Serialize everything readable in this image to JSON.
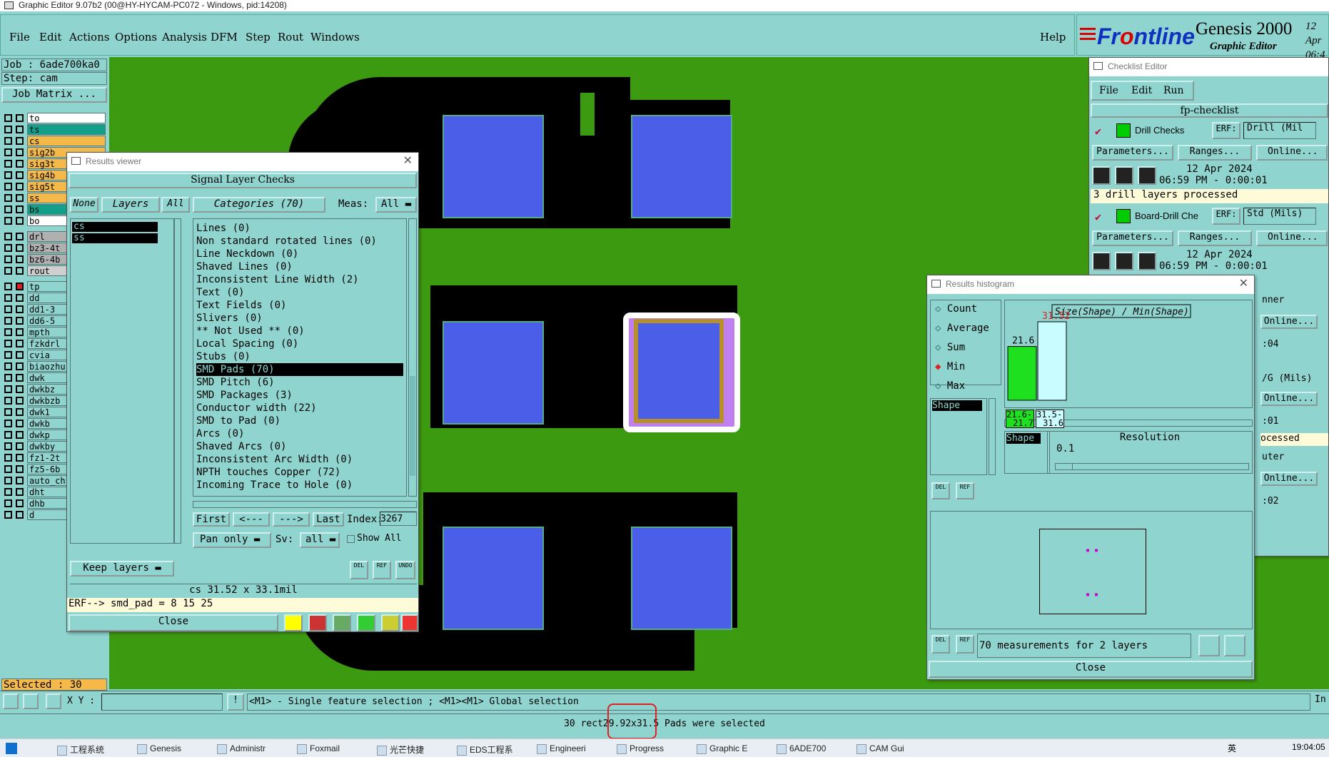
{
  "window_title": "Graphic Editor 9.07b2 (00@HY-HYCAM-PC072 - Windows, pid:14208)",
  "menu": [
    "File",
    "Edit",
    "Actions",
    "Options",
    "Analysis",
    "DFM",
    "Step",
    "Rout",
    "Windows"
  ],
  "help": "Help",
  "logo": {
    "brand_a": "Fr",
    "brand_b": "ntline",
    "product": "Genesis 2000",
    "sub": "Graphic Editor",
    "date_line": "12 Apr",
    "time_line": "06:4"
  },
  "left": {
    "job": "Job : 6ade700ka0",
    "step": "Step: cam",
    "job_matrix": "Job Matrix ...",
    "layers_top": [
      {
        "name": "to",
        "color": "#ffffff"
      },
      {
        "name": "ts",
        "color": "#12a08a"
      },
      {
        "name": "cs",
        "color": "#f5b94a"
      },
      {
        "name": "sig2b",
        "color": "#f5b94a"
      },
      {
        "name": "sig3t",
        "color": "#f5b94a"
      },
      {
        "name": "sig4b",
        "color": "#f5b94a"
      },
      {
        "name": "sig5t",
        "color": "#f5b94a"
      },
      {
        "name": "ss",
        "color": "#f5b94a"
      },
      {
        "name": "bs",
        "color": "#12a08a"
      },
      {
        "name": "bo",
        "color": "#ffffff"
      }
    ],
    "layers_drill": [
      {
        "name": "drl",
        "color": "#b0b0b0"
      },
      {
        "name": "bz3-4t",
        "color": "#b0b0b0"
      },
      {
        "name": "bz6-4b",
        "color": "#b0b0b0"
      },
      {
        "name": "rout",
        "color": "#cfcfcf"
      }
    ],
    "layers_misc": [
      "tp",
      "dd",
      "dd1-3",
      "dd6-5",
      "mpth",
      "fzkdrl",
      "cvia",
      "biaozhu",
      "dwk",
      "dwkbz",
      "dwkbzb",
      "dwk1",
      "dwkb",
      "dwkp",
      "dwkby",
      "fz1-2t",
      "fz5-6b",
      "auto_chk",
      "dht",
      "dhb",
      "d"
    ],
    "selected": "Selected : 30"
  },
  "results_viewer": {
    "title": "Results viewer",
    "header": "Signal Layer Checks",
    "none": "None",
    "layers": "Layers",
    "all": "All",
    "categories_btn": "Categories (70)",
    "meas_label": "Meas:",
    "meas_value": "All",
    "layer_list": [
      "cs",
      "ss"
    ],
    "categories": [
      "Lines (0)",
      "Non standard rotated lines (0)",
      "Line Neckdown (0)",
      "Shaved Lines (0)",
      "Inconsistent Line Width (2)",
      "Text (0)",
      "Text Fields (0)",
      "Slivers (0)",
      "** Not Used ** (0)",
      "Local Spacing (0)",
      "Stubs (0)",
      "SMD Pads (70)",
      "SMD Pitch (6)",
      "SMD Packages (3)",
      "Conductor width (22)",
      "SMD to Pad (0)",
      "Arcs (0)",
      "Shaved Arcs (0)",
      "Inconsistent Arc Width (0)",
      "NPTH touches Copper (72)",
      "Incoming Trace to Hole (0)"
    ],
    "selected_category": "SMD Pads (70)",
    "first": "First",
    "prev": "<---",
    "next": "--->",
    "last": "Last",
    "index_label": "Index:",
    "index_value": "3267",
    "pan": "Pan only",
    "sv_label": "Sv:",
    "sv_value": "all",
    "show_all": "Show All",
    "keep_layers": "Keep layers",
    "del": "DEL",
    "ref": "REF",
    "undo": "UNDO",
    "info": "cs 31.52 x 33.1mil",
    "erf": "ERF--> smd_pad = 8 15 25",
    "close": "Close"
  },
  "checklist": {
    "title": "Checklist Editor",
    "menu": [
      "File",
      "Edit",
      "Run"
    ],
    "name": "fp-checklist",
    "drill": {
      "label": "Drill Checks",
      "erf": "ERF:",
      "erf_value": "Drill (Mil",
      "params": "Parameters...",
      "ranges": "Ranges...",
      "online": "Online...",
      "date": "12 Apr 2024",
      "time": "06:59 PM - 0:00:01",
      "status": "3 drill layers processed"
    },
    "board": {
      "label": "Board-Drill Che",
      "erf": "ERF:",
      "erf_value": "Std (Mils)",
      "params": "Parameters...",
      "ranges": "Ranges...",
      "online": "Online...",
      "date": "12 Apr 2024",
      "time": "06:59 PM - 0:00:01"
    },
    "partial": [
      "nner",
      "Online...",
      ":04",
      "/G (Mils)",
      "Online...",
      ":01",
      "ocessed",
      "uter",
      "Online...",
      ":02"
    ]
  },
  "histogram": {
    "title": "Results histogram",
    "options": [
      "Count",
      "Average",
      "Sum",
      "Min",
      "Max"
    ],
    "selected_option": "Min",
    "chart_title": "Size(Shape) / Min(Shape)",
    "shape": "Shape",
    "bars": [
      {
        "label": "21.6",
        "range_top": "21.6-",
        "range_bot": "21.7",
        "value": 21.6,
        "color": "#1ee01e"
      },
      {
        "label": "31.52",
        "range_top": "31.5-",
        "range_bot": "31.6",
        "value": 31.52,
        "color": "#c8fcff"
      }
    ],
    "resolution_label": "Resolution",
    "resolution_value": "0.1",
    "footer": "70 measurements for 2 layers",
    "close": "Close",
    "del": "DEL",
    "ref": "REF"
  },
  "bottom": {
    "xy_label": "X Y :",
    "hint": "<M1> - Single feature selection ; <M1><M1> Global selection",
    "message": "30 rect29.92x31.5 Pads were selected",
    "partial_right": "In"
  },
  "taskbar": {
    "items": [
      "工程系统",
      "Genesis",
      "Administr",
      "Foxmail",
      "光芒快捷",
      "EDS工程系",
      "Engineeri",
      "Progress",
      "Graphic E",
      "6ADE700",
      "CAM Gui"
    ],
    "time": "19:04:05",
    "ime": "英"
  }
}
